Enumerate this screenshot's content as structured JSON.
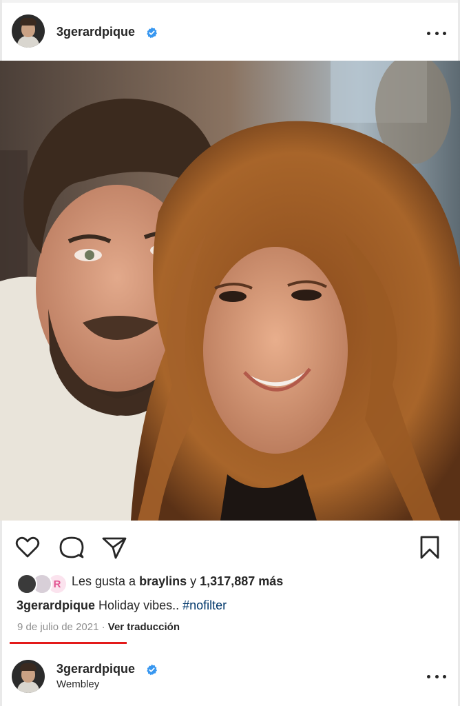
{
  "post": {
    "username": "3gerardpique",
    "verified_icon": "verified-badge-icon",
    "more_icon": "more-horizontal-icon"
  },
  "actions": {
    "like_icon": "heart-icon",
    "comment_icon": "comment-icon",
    "share_icon": "send-icon",
    "save_icon": "bookmark-icon"
  },
  "likes": {
    "prefix": "Les gusta a",
    "user": "braylins",
    "connector": "y",
    "count": "1,317,887",
    "suffix": "más",
    "badge_letter": "R"
  },
  "caption": {
    "user": "3gerardpique",
    "text": "Holiday vibes..",
    "hashtag": "#nofilter"
  },
  "meta": {
    "date": "9 de julio de 2021",
    "separator": "·",
    "translate": "Ver traducción"
  },
  "next_post": {
    "username": "3gerardpique",
    "location": "Wembley"
  },
  "colors": {
    "verified": "#3897f0",
    "hashtag": "#00376b",
    "meta": "#8e8e8e",
    "underline": "#e31a1a"
  }
}
